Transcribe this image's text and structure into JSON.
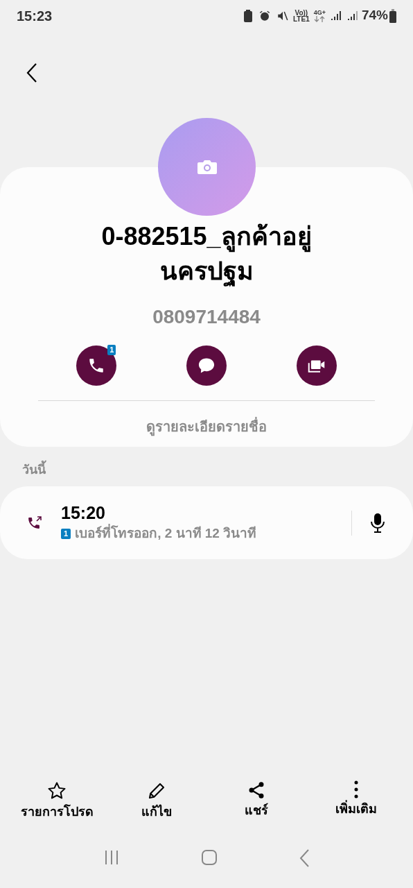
{
  "status_bar": {
    "time": "15:23",
    "volte": "Vo))",
    "lte": "LTE1",
    "network": "4G+",
    "battery": "74%"
  },
  "contact": {
    "name": "0-882515_ลูกค้าอยู่นครปฐม",
    "phone": "0809714484"
  },
  "actions": [
    {
      "kind": "call",
      "badge": "1"
    },
    {
      "kind": "message"
    },
    {
      "kind": "video"
    }
  ],
  "details_link": "ดูรายละเอียดรายชื่อ",
  "section_title": "วันนี้",
  "call_log": [
    {
      "kind": "outgoing",
      "time": "15:20",
      "sim": "1",
      "description": "เบอร์ที่โทรออก, 2 นาที 12 วินาที"
    }
  ],
  "bottom_actions": [
    {
      "kind": "favorite",
      "label": "รายการโปรด"
    },
    {
      "kind": "edit",
      "label": "แก้ไข"
    },
    {
      "kind": "share",
      "label": "แชร์"
    },
    {
      "kind": "more",
      "label": "เพิ่มเติม"
    }
  ]
}
